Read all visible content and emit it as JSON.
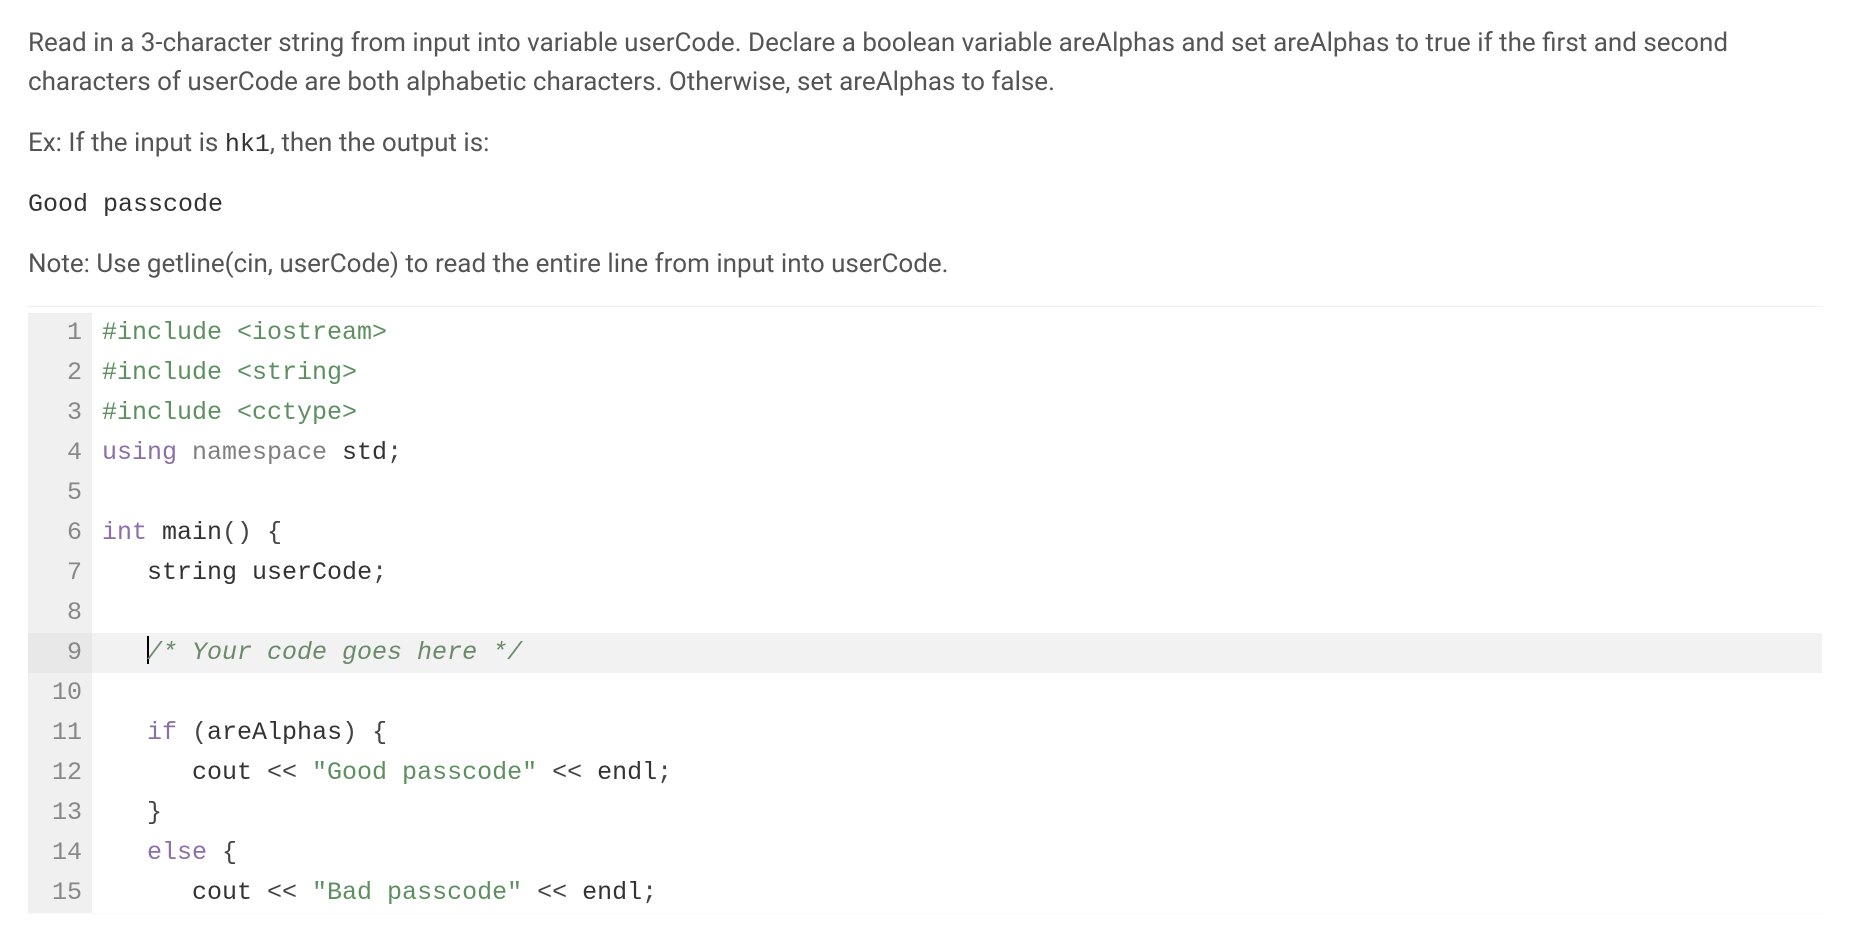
{
  "instructions": {
    "p1": "Read in a 3-character string from input into variable userCode. Declare a boolean variable areAlphas and set areAlphas to true if the first and second characters of userCode are both alphabetic characters. Otherwise, set areAlphas to false.",
    "p2_prefix": "Ex: If the input is ",
    "p2_code": "hk1",
    "p2_suffix": ", then the output is:",
    "output_block": "Good passcode",
    "p3": "Note: Use getline(cin, userCode) to read the entire line from input into userCode."
  },
  "editor": {
    "highlighted_line": 9,
    "lines": [
      {
        "n": 1,
        "tokens": [
          [
            "pp",
            "#include "
          ],
          [
            "inc",
            "<iostream>"
          ]
        ]
      },
      {
        "n": 2,
        "tokens": [
          [
            "pp",
            "#include "
          ],
          [
            "inc",
            "<string>"
          ]
        ]
      },
      {
        "n": 3,
        "tokens": [
          [
            "pp",
            "#include "
          ],
          [
            "inc",
            "<cctype>"
          ]
        ]
      },
      {
        "n": 4,
        "tokens": [
          [
            "kw",
            "using "
          ],
          [
            "ns",
            "namespace "
          ],
          [
            "id",
            "std"
          ],
          [
            "pn",
            ";"
          ]
        ]
      },
      {
        "n": 5,
        "tokens": [
          [
            "id",
            ""
          ]
        ]
      },
      {
        "n": 6,
        "tokens": [
          [
            "kw2",
            "int "
          ],
          [
            "fn",
            "main"
          ],
          [
            "pn",
            "() {"
          ]
        ]
      },
      {
        "n": 7,
        "tokens": [
          [
            "id",
            "   "
          ],
          [
            "ty",
            "string "
          ],
          [
            "id",
            "userCode"
          ],
          [
            "pn",
            ";"
          ]
        ]
      },
      {
        "n": 8,
        "tokens": [
          [
            "id",
            ""
          ]
        ]
      },
      {
        "n": 9,
        "tokens": [
          [
            "id",
            "   "
          ],
          [
            "cursor",
            ""
          ],
          [
            "cm",
            "/* Your code goes here */"
          ]
        ],
        "hl": true
      },
      {
        "n": 10,
        "tokens": [
          [
            "id",
            ""
          ]
        ]
      },
      {
        "n": 11,
        "tokens": [
          [
            "id",
            "   "
          ],
          [
            "kw",
            "if "
          ],
          [
            "pn",
            "("
          ],
          [
            "id",
            "areAlphas"
          ],
          [
            "pn",
            ") {"
          ]
        ]
      },
      {
        "n": 12,
        "tokens": [
          [
            "id",
            "      "
          ],
          [
            "id",
            "cout "
          ],
          [
            "op",
            "<< "
          ],
          [
            "str",
            "\"Good passcode\""
          ],
          [
            "op",
            " << "
          ],
          [
            "id",
            "endl"
          ],
          [
            "pn",
            ";"
          ]
        ]
      },
      {
        "n": 13,
        "tokens": [
          [
            "id",
            "   "
          ],
          [
            "pn",
            "}"
          ]
        ]
      },
      {
        "n": 14,
        "tokens": [
          [
            "id",
            "   "
          ],
          [
            "kw",
            "else "
          ],
          [
            "pn",
            "{"
          ]
        ]
      },
      {
        "n": 15,
        "tokens": [
          [
            "id",
            "      "
          ],
          [
            "id",
            "cout "
          ],
          [
            "op",
            "<< "
          ],
          [
            "str",
            "\"Bad passcode\""
          ],
          [
            "op",
            " << "
          ],
          [
            "id",
            "endl"
          ],
          [
            "pn",
            ";"
          ]
        ]
      }
    ]
  }
}
